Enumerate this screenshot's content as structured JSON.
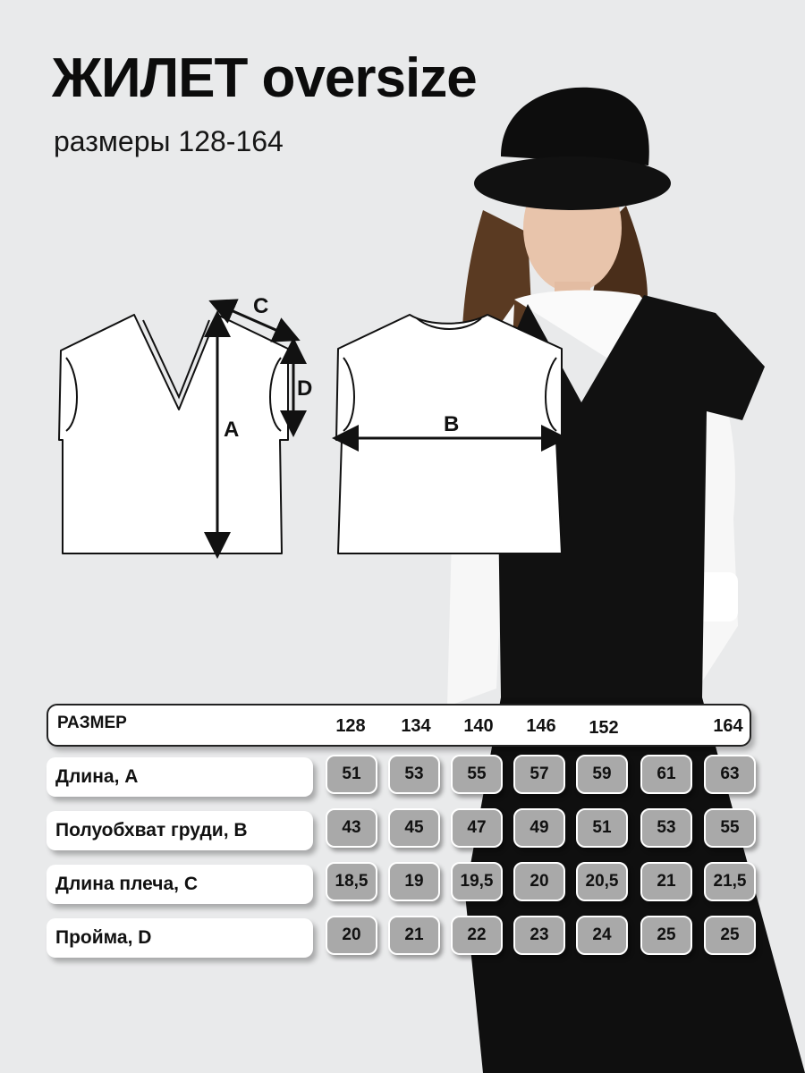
{
  "header": {
    "title": "ЖИЛЕТ oversize",
    "subtitle": "размеры 128-164"
  },
  "diagram": {
    "labels": {
      "a": "A",
      "b": "B",
      "c": "C",
      "d": "D"
    }
  },
  "table": {
    "header_label": "РАЗМЕР",
    "sizes": [
      "128",
      "134",
      "140",
      "146",
      "152",
      "",
      "164"
    ],
    "rows": [
      {
        "label": "Длина, А",
        "values": [
          "51",
          "53",
          "55",
          "57",
          "59",
          "61",
          "63"
        ]
      },
      {
        "label": "Полуобхват груди, В",
        "values": [
          "43",
          "45",
          "47",
          "49",
          "51",
          "53",
          "55"
        ]
      },
      {
        "label": "Длина плеча, С",
        "values": [
          "18,5",
          "19",
          "19,5",
          "20",
          "20,5",
          "21",
          "21,5"
        ]
      },
      {
        "label": "Пройма, D",
        "values": [
          "20",
          "21",
          "22",
          "23",
          "24",
          "25",
          "25"
        ]
      }
    ]
  },
  "colors": {
    "background": "#e9eaeb",
    "cell_fill": "#a9a9a9",
    "garment": "#111111",
    "sleeve": "#ffffff"
  }
}
